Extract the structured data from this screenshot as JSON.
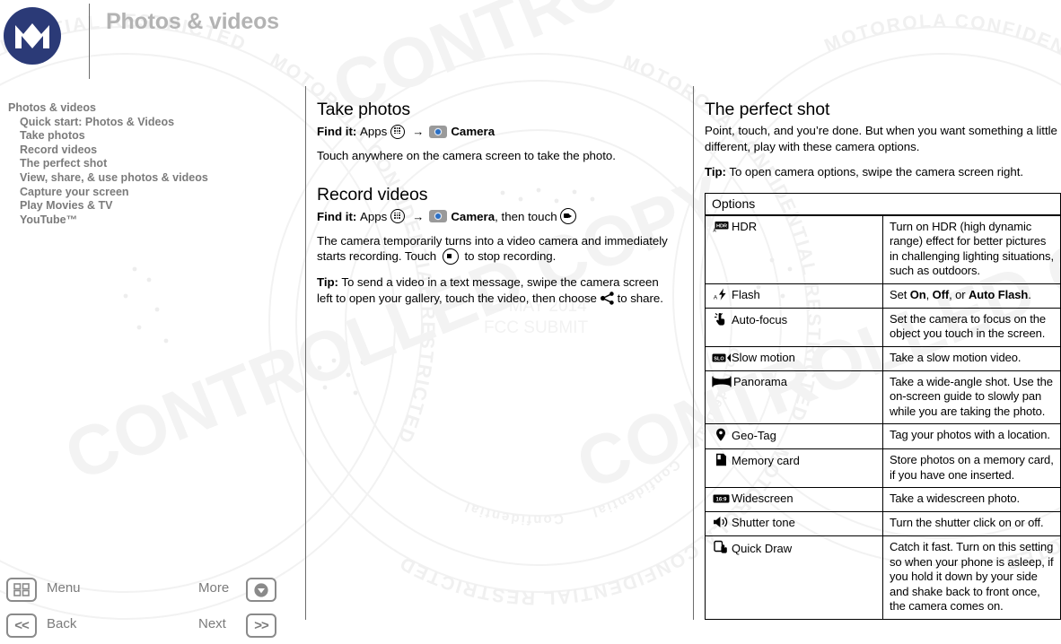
{
  "header": {
    "title": "Photos & videos",
    "logo_icon": "motorola-logo"
  },
  "stamp": {
    "line1": "23 MAY 2014",
    "line2": "FCC SUBMIT"
  },
  "watermarks": {
    "ring_text": "MOTOROLA CONFIDENTIAL RESTRICTED",
    "big_text_1": "CONTROLLED COPY",
    "big_text_2": "Confidential"
  },
  "toc": {
    "items": [
      {
        "label": "Photos & videos",
        "level": 1
      },
      {
        "label": "Quick start: Photos & Videos",
        "level": 2
      },
      {
        "label": "Take photos",
        "level": 2
      },
      {
        "label": "Record videos",
        "level": 2
      },
      {
        "label": "The perfect shot",
        "level": 2
      },
      {
        "label": "View, share, & use photos & videos",
        "level": 2
      },
      {
        "label": "Capture your screen",
        "level": 2
      },
      {
        "label": "Play Movies & TV",
        "level": 2
      },
      {
        "label": "YouTube™",
        "level": 2
      }
    ]
  },
  "bottom_nav": {
    "menu_label": "Menu",
    "more_label": "More",
    "back_label": "Back",
    "next_label": "Next",
    "back_glyph": "<<",
    "next_glyph": ">>"
  },
  "middle_column": {
    "section1": {
      "heading": "Take photos",
      "findit_label": "Find it:",
      "findit_apps": "Apps",
      "findit_arrow": "→",
      "findit_camera": "Camera",
      "body": "Touch anywhere on the camera screen to take the photo."
    },
    "section2": {
      "heading": "Record videos",
      "findit_label": "Find it:",
      "findit_apps": "Apps",
      "findit_arrow": "→",
      "findit_camera": "Camera",
      "findit_then": ", then touch",
      "body_part1": "The camera temporarily turns into a video camera and immediately starts recording. Touch",
      "body_part2": "to stop recording.",
      "tip_label": "Tip:",
      "tip_part1": "To send a video in a text message, swipe the camera screen left to open your gallery, touch the video, then choose",
      "tip_part2": "to share."
    }
  },
  "right_column": {
    "heading": "The perfect shot",
    "intro": "Point, touch, and you’re done. But when you want something a little different, play with these camera options.",
    "tip_label": "Tip:",
    "tip_text": "To open camera options, swipe the camera screen right.",
    "table": {
      "header": "Options",
      "rows": [
        {
          "icon": "hdr-icon",
          "name": "HDR",
          "desc": "Turn on HDR (high dynamic range) effect for better pictures in challenging lighting situations, such as outdoors."
        },
        {
          "icon": "flash-icon",
          "name": "Flash",
          "desc": "Set On, Off, or Auto Flash.",
          "desc_rich": [
            {
              "t": "Set ",
              "b": false
            },
            {
              "t": "On",
              "b": true
            },
            {
              "t": ", ",
              "b": false
            },
            {
              "t": "Off",
              "b": true
            },
            {
              "t": ", or ",
              "b": false
            },
            {
              "t": "Auto Flash",
              "b": true
            },
            {
              "t": ".",
              "b": false
            }
          ]
        },
        {
          "icon": "auto-focus-icon",
          "name": "Auto-focus",
          "desc": "Set the camera to focus on the object you touch in the screen."
        },
        {
          "icon": "slow-motion-icon",
          "name": "Slow motion",
          "desc": "Take a slow motion video."
        },
        {
          "icon": "panorama-icon",
          "name": "Panorama",
          "desc": "Take a wide-angle shot. Use the on-screen guide to slowly pan while you are taking the photo."
        },
        {
          "icon": "geo-tag-icon",
          "name": "Geo-Tag",
          "desc": "Tag your photos with a location."
        },
        {
          "icon": "memory-card-icon",
          "name": "Memory card",
          "desc": "Store photos on a memory card, if you have one inserted."
        },
        {
          "icon": "widescreen-icon",
          "name": "Widescreen",
          "desc": "Take a widescreen photo."
        },
        {
          "icon": "shutter-tone-icon",
          "name": "Shutter tone",
          "desc": "Turn the shutter click on or off."
        },
        {
          "icon": "quick-draw-icon",
          "name": "Quick Draw",
          "desc": "Catch it fast. Turn on this setting so when your phone is asleep, if you hold it down by your side and shake back to front once, the camera comes on."
        }
      ]
    }
  },
  "colors": {
    "brand_blue": "#2b3a77",
    "camera_blue": "#2a6fc4",
    "title_gray": "#b3b3b3",
    "toc_gray": "#7b7b7b",
    "rule_gray": "#6d6d6d",
    "watermark_gray": "#f2f2f2"
  }
}
